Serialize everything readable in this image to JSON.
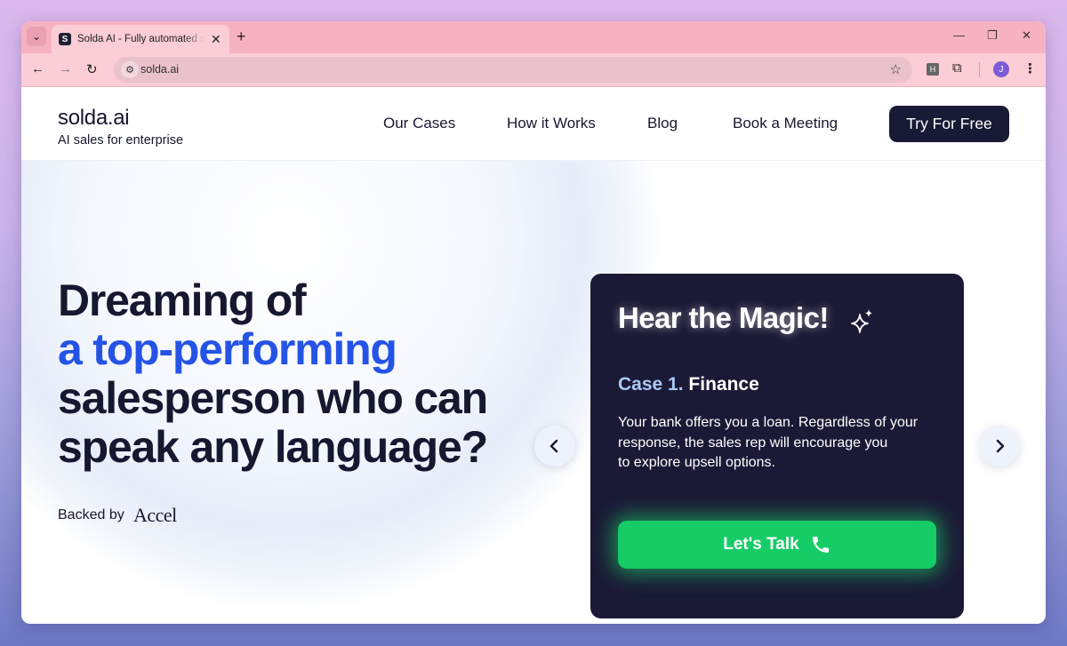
{
  "browser": {
    "tab_title": "Solda AI - Fully automated sales",
    "favicon_letter": "S",
    "url": "solda.ai",
    "profile_initial": "J",
    "extension_label": "H"
  },
  "header": {
    "logo": "solda.ai",
    "tagline": "AI sales for enterprise",
    "nav": [
      "Our Cases",
      "How it Works",
      "Blog",
      "Book a Meeting"
    ],
    "cta": "Try For Free"
  },
  "hero": {
    "line1": "Dreaming of",
    "line2": "a top-performing",
    "line3": "salesperson who can",
    "line4": "speak any language?",
    "backed_by": "Backed by",
    "investor": "Accel"
  },
  "card": {
    "title": "Hear the Magic!",
    "case_number": "Case 1.",
    "case_category": "Finance",
    "description_lines": [
      "Your bank offers you a loan. Regardless of your",
      "response, the sales rep will encourage you",
      "to explore upsell options."
    ],
    "button": "Let's Talk"
  },
  "colors": {
    "accent": "#2453e6",
    "dark": "#181a36",
    "cta_green": "#16cc66",
    "case_blue": "#a9c9f5"
  },
  "icons": [
    "chevron-left-icon",
    "chevron-right-icon",
    "sparkle-icon",
    "phone-icon"
  ]
}
